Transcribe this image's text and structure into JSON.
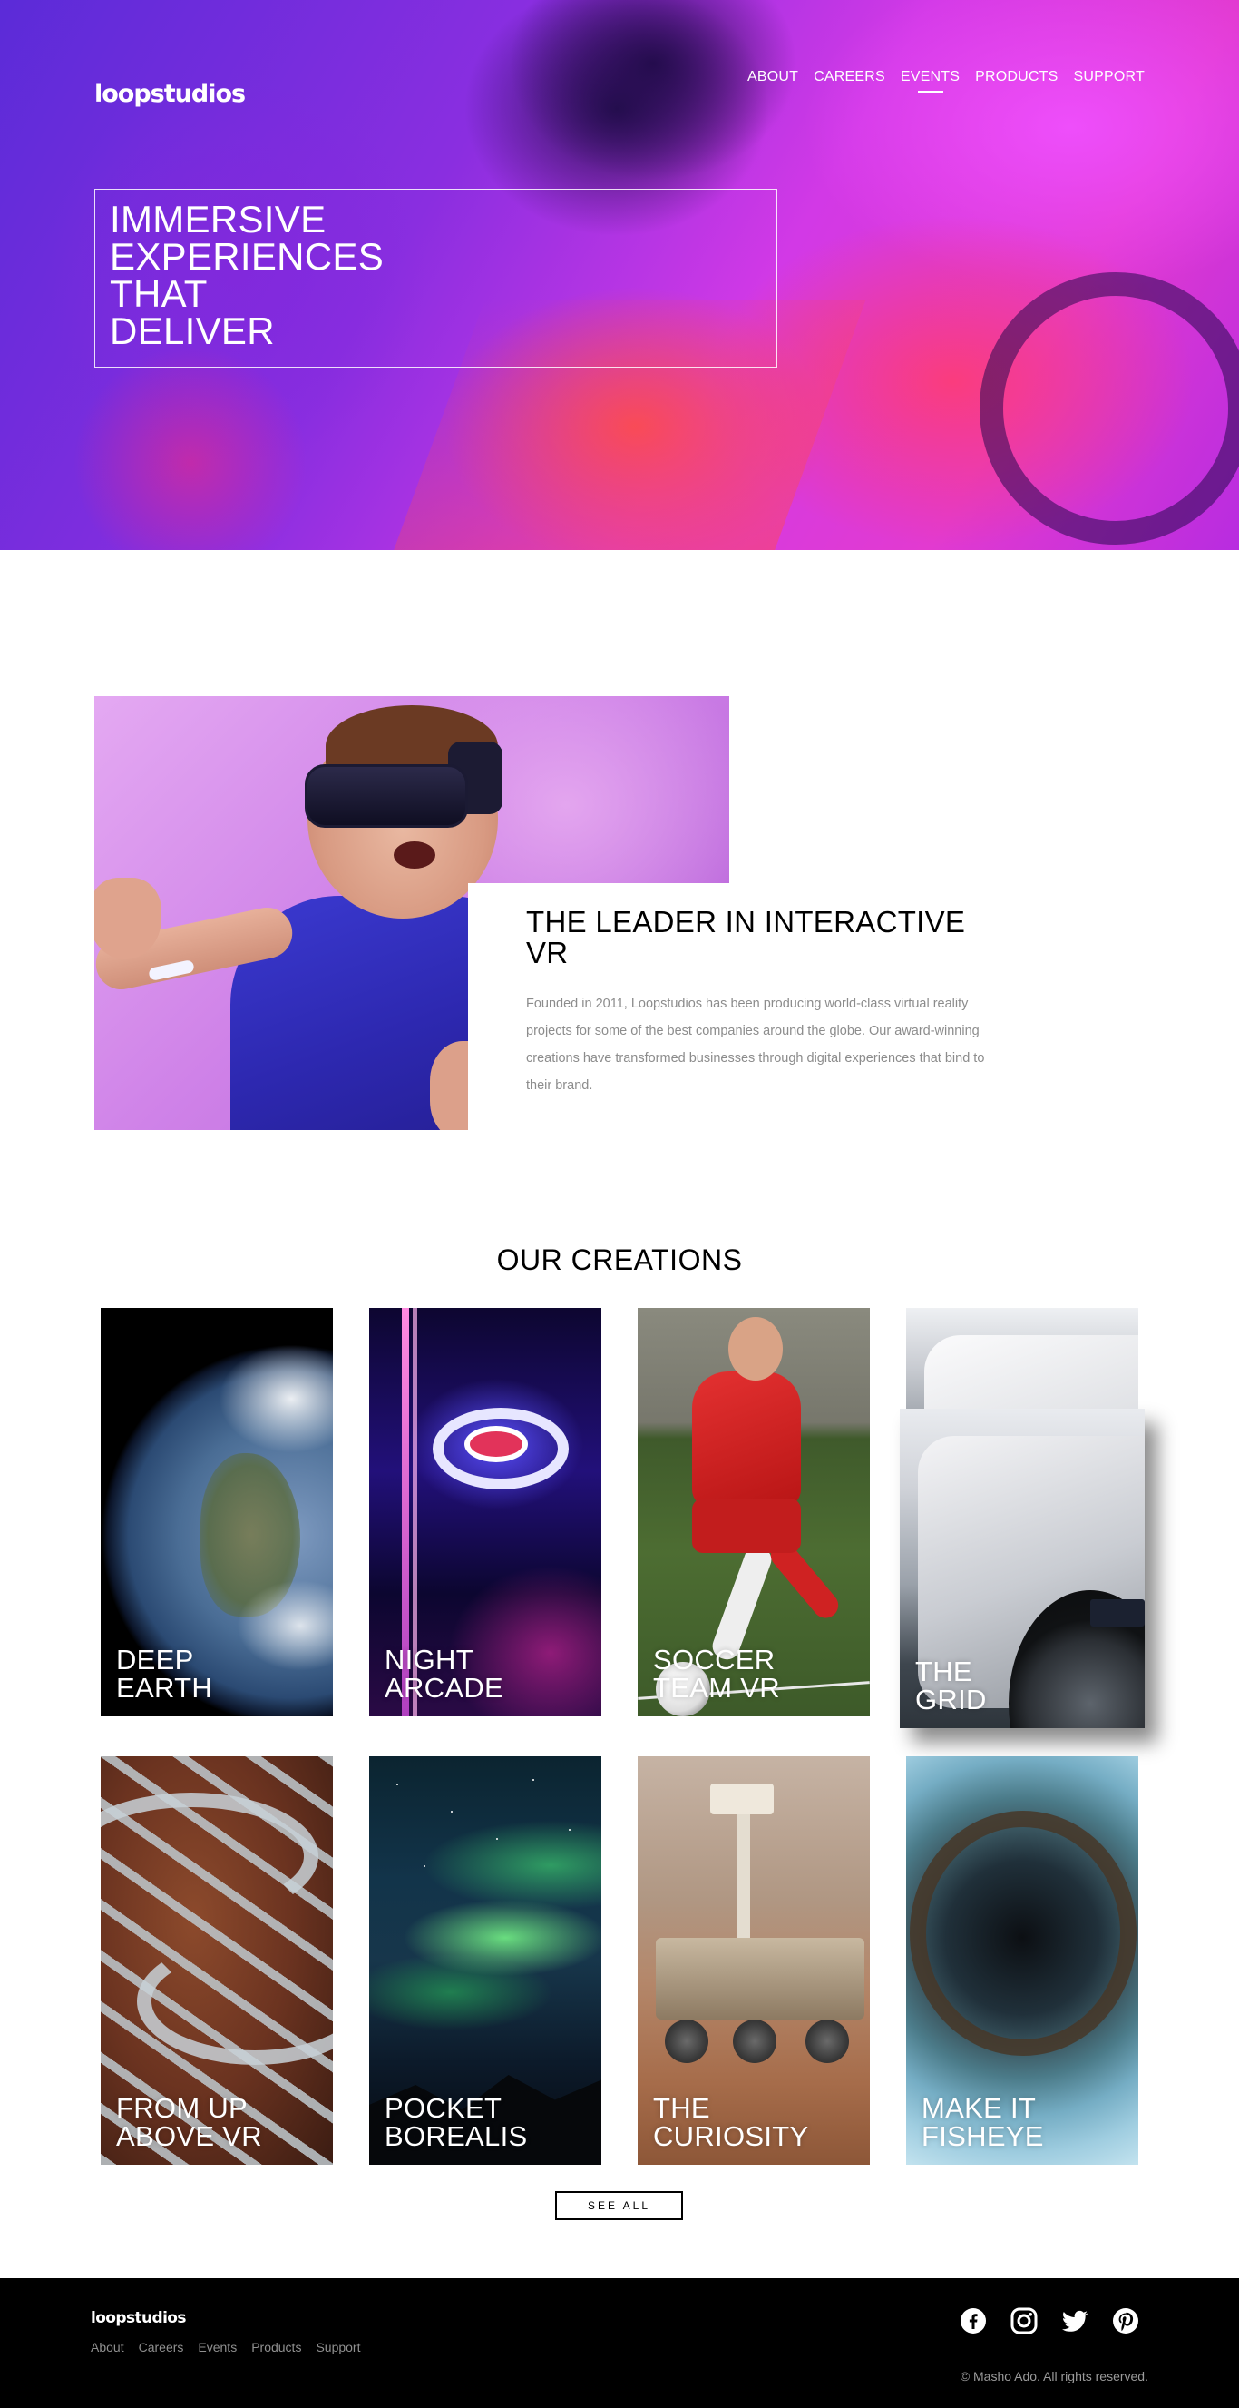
{
  "header": {
    "logo": "loopstudios",
    "nav": [
      "ABOUT",
      "CAREERS",
      "EVENTS",
      "PRODUCTS",
      "SUPPORT"
    ],
    "active_nav": "EVENTS"
  },
  "hero": {
    "title": "IMMERSIVE\nEXPERIENCES\nTHAT\nDELIVER"
  },
  "leader": {
    "title": "THE LEADER IN INTERACTIVE VR",
    "text": "Founded in 2011, Loopstudios has been producing world-class virtual reality projects for some of the best companies around the globe. Our award-winning creations have transformed businesses through digital experiences that bind to their brand."
  },
  "creations": {
    "title": "OUR CREATIONS",
    "items": [
      {
        "label": "DEEP\nEARTH"
      },
      {
        "label": "NIGHT\nARCADE"
      },
      {
        "label": "SOCCER\nTEAM VR"
      },
      {
        "label": "THE\nGRID"
      },
      {
        "label": "FROM UP\nABOVE VR"
      },
      {
        "label": "POCKET\nBOREALIS"
      },
      {
        "label": "THE\nCURIOSITY"
      },
      {
        "label": "MAKE IT\nFISHEYE"
      }
    ],
    "see_all": "SEE ALL"
  },
  "footer": {
    "logo": "loopstudios",
    "nav": [
      "About",
      "Careers",
      "Events",
      "Products",
      "Support"
    ],
    "social_icons": [
      "facebook-icon",
      "instagram-icon",
      "twitter-icon",
      "pinterest-icon"
    ],
    "copyright": "© Masho Ado. All rights reserved."
  },
  "colors": {
    "hero_gradient": [
      "#5b2bd8",
      "#d239e6",
      "#e23ad0"
    ],
    "footer_bg": "#000000",
    "body_text": "#8c8c8c"
  }
}
